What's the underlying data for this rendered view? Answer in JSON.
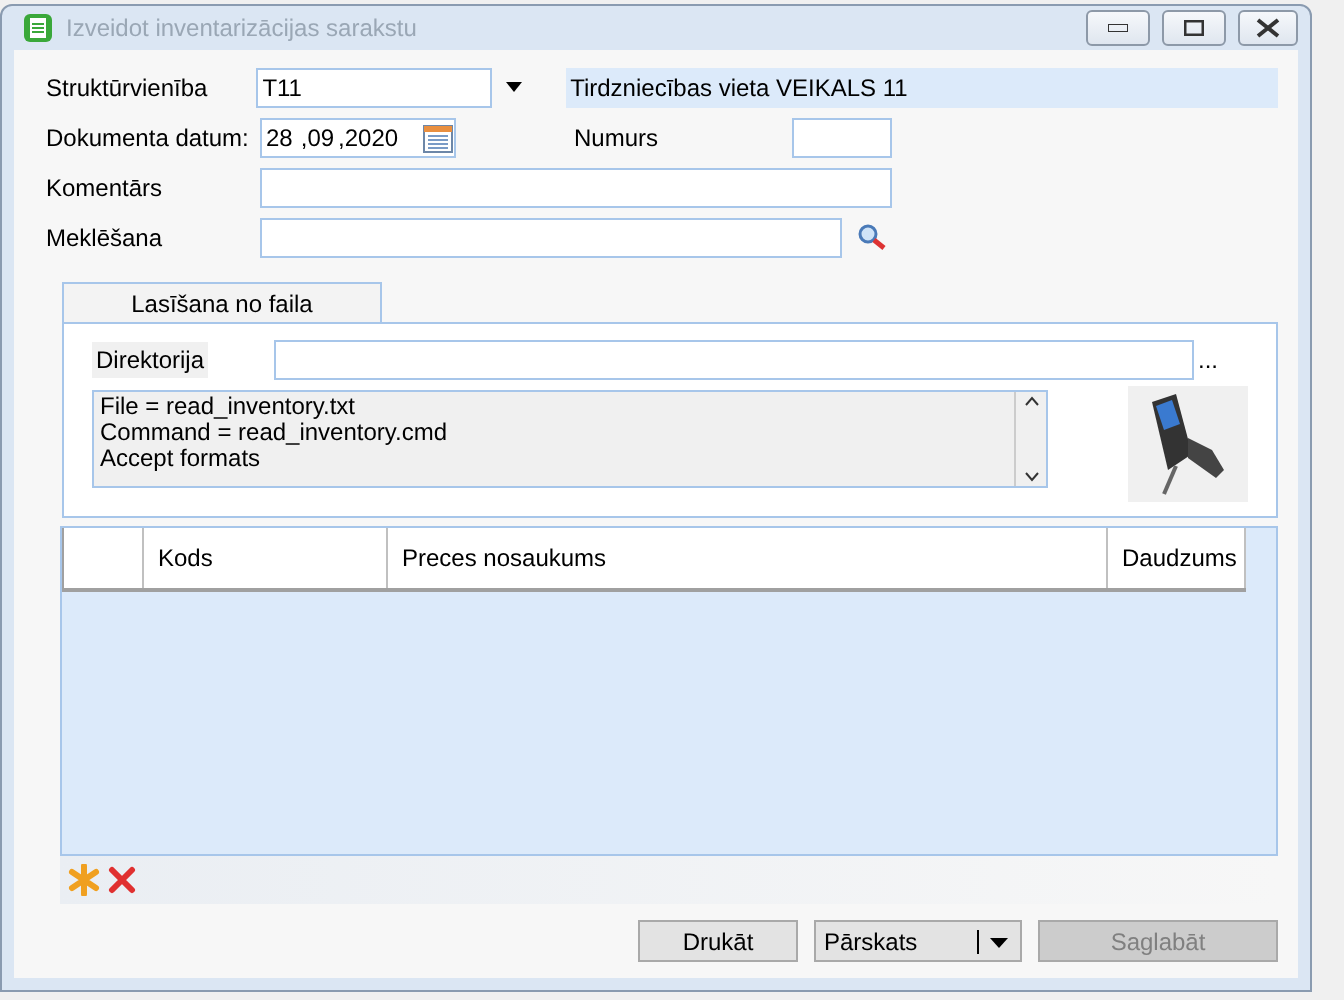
{
  "window": {
    "title": "Izveidot inventarizācijas sarakstu"
  },
  "form": {
    "unit_label": "Struktūrvienība",
    "unit_value": "T11",
    "unit_description": "Tirdzniecības vieta VEIKALS 11",
    "date_label": "Dokumenta datum:",
    "date_day": "28",
    "date_month": ",09",
    "date_year": ",2020",
    "number_label": "Numurs",
    "comment_label": "Komentārs",
    "search_label": "Meklēšana"
  },
  "tabs": [
    {
      "label": "Lasīšana no faila",
      "selected": true
    }
  ],
  "file_panel": {
    "directory_label": "Direktorija",
    "browse": "...",
    "info_lines": [
      "File = read_inventory.txt",
      "Command = read_inventory.cmd",
      "Accept formats"
    ]
  },
  "table": {
    "columns": [
      "",
      "Kods",
      "Preces nosaukums",
      "Daudzums"
    ]
  },
  "buttons": [
    {
      "label": "Drukāt",
      "kind": "button",
      "disabled": false
    },
    {
      "label": "Pārskats",
      "kind": "dropdown",
      "disabled": false
    },
    {
      "label": "Saglabāt",
      "kind": "button",
      "disabled": true
    }
  ]
}
